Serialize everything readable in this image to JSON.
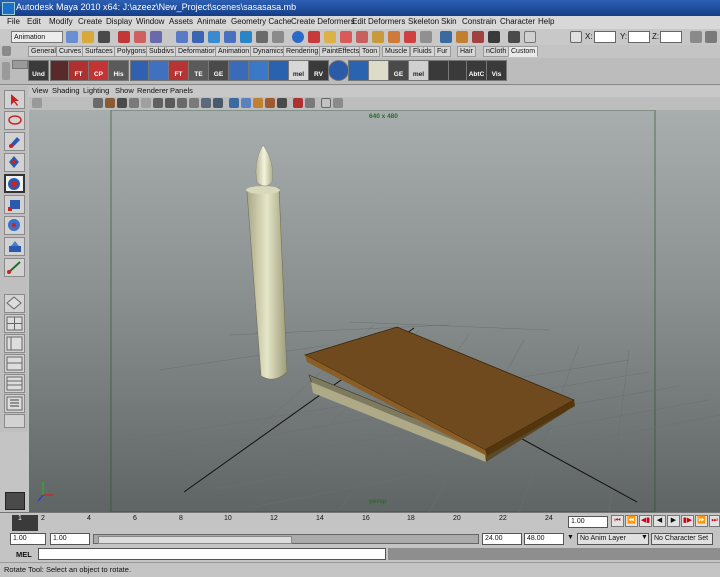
{
  "window": {
    "title": "Autodesk Maya 2010 x64: J:\\azeez\\New_Project\\scenes\\sasasasa.mb"
  },
  "menus": [
    "File",
    "Edit",
    "Modify",
    "Create",
    "Display",
    "Window",
    "Assets",
    "Animate",
    "Geometry Cache",
    "Create Deformers",
    "Edit Deformers",
    "Skeleton",
    "Skin",
    "Constrain",
    "Character",
    "Help"
  ],
  "status_line": {
    "mode": "Animation",
    "x_label": "X:",
    "y_label": "Y:",
    "z_label": "Z:"
  },
  "shelf_tabs": [
    "General",
    "Curves",
    "Surfaces",
    "Polygons",
    "Subdivs",
    "Deformation",
    "Animation",
    "Dynamics",
    "Rendering",
    "PaintEffects",
    "Toon",
    "Muscle",
    "Fluids",
    "Fur",
    "Hair",
    "nCloth",
    "Custom"
  ],
  "shelf_active_tab": "Custom",
  "shelf_buttons": [
    "Und",
    "",
    "FT",
    "CP",
    "His",
    "",
    "",
    "FT",
    "TE",
    "GE",
    "",
    "",
    "",
    "mel",
    "RV",
    "",
    "",
    "",
    "GE",
    "mel",
    "",
    "",
    "AbtC",
    "Vis"
  ],
  "viewport": {
    "menu": [
      "View",
      "Shading",
      "Lighting",
      "Show",
      "Renderer",
      "Panels"
    ],
    "resolution_gate": "640 x 480",
    "camera_name": "persp"
  },
  "time_slider": {
    "ticks": [
      "1",
      "2",
      "4",
      "6",
      "8",
      "10",
      "12",
      "14",
      "16",
      "18",
      "20",
      "22",
      "24"
    ],
    "current_frame": "1.00"
  },
  "range_slider": {
    "start": "1.00",
    "playback_start": "1.00",
    "playback_end": "24.00",
    "end": "48.00",
    "anim_layer": "No Anim Layer",
    "character_set": "No Character Set"
  },
  "command_line": {
    "label": "MEL"
  },
  "help_line": {
    "text": "Rotate Tool: Select an object to rotate."
  }
}
